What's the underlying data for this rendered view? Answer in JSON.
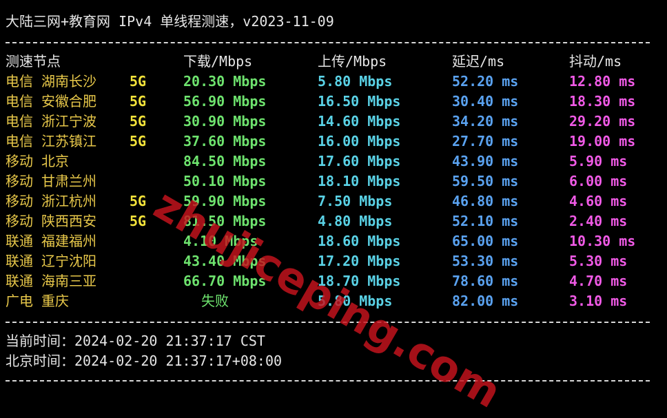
{
  "title": "大陆三网+教育网 IPv4 单线程测速，v2023-11-09",
  "header": {
    "node": "测速节点",
    "download": "下载/Mbps",
    "upload": "上传/Mbps",
    "latency": "延迟/ms",
    "jitter": "抖动/ms"
  },
  "rows": [
    {
      "node": "电信 湖南长沙",
      "tag": "5G",
      "download": "20.30 Mbps",
      "upload": "5.80 Mbps",
      "latency": "52.20 ms",
      "jitter": "12.80 ms"
    },
    {
      "node": "电信 安徽合肥",
      "tag": "5G",
      "download": "56.90 Mbps",
      "upload": "16.50 Mbps",
      "latency": "30.40 ms",
      "jitter": "18.30 ms"
    },
    {
      "node": "电信 浙江宁波",
      "tag": "5G",
      "download": "30.90 Mbps",
      "upload": "14.60 Mbps",
      "latency": "34.20 ms",
      "jitter": "29.20 ms"
    },
    {
      "node": "电信 江苏镇江",
      "tag": "5G",
      "download": "37.60 Mbps",
      "upload": "16.00 Mbps",
      "latency": "27.70 ms",
      "jitter": "19.00 ms"
    },
    {
      "node": "移动 北京",
      "tag": "",
      "download": "84.50 Mbps",
      "upload": "17.60 Mbps",
      "latency": "43.90 ms",
      "jitter": "5.90 ms"
    },
    {
      "node": "移动 甘肃兰州",
      "tag": "",
      "download": "50.10 Mbps",
      "upload": "18.10 Mbps",
      "latency": "59.50 ms",
      "jitter": "6.00 ms"
    },
    {
      "node": "移动 浙江杭州",
      "tag": "5G",
      "download": "59.90 Mbps",
      "upload": "7.50 Mbps",
      "latency": "46.80 ms",
      "jitter": "4.60 ms"
    },
    {
      "node": "移动 陕西西安",
      "tag": "5G",
      "download": "81.50 Mbps",
      "upload": "4.80 Mbps",
      "latency": "52.10 ms",
      "jitter": "2.40 ms"
    },
    {
      "node": "联通 福建福州",
      "tag": "",
      "download": "4.10 Mbps",
      "upload": "18.60 Mbps",
      "latency": "65.00 ms",
      "jitter": "10.30 ms"
    },
    {
      "node": "联通 辽宁沈阳",
      "tag": "",
      "download": "43.40 Mbps",
      "upload": "17.20 Mbps",
      "latency": "53.30 ms",
      "jitter": "5.30 ms"
    },
    {
      "node": "联通 海南三亚",
      "tag": "",
      "download": "66.70 Mbps",
      "upload": "18.70 Mbps",
      "latency": "78.60 ms",
      "jitter": "4.70 ms"
    },
    {
      "node": "广电 重庆",
      "tag": "",
      "download": "",
      "failed": "失败",
      "upload": "5.80 Mbps",
      "latency": "82.00 ms",
      "jitter": "3.10 ms"
    }
  ],
  "footer": {
    "current_time": "当前时间：2024-02-20 21:37:17 CST",
    "beijing_time": "北京时间：2024-02-20 21:37:17+08:00"
  },
  "watermark": "zhujiceping.com"
}
